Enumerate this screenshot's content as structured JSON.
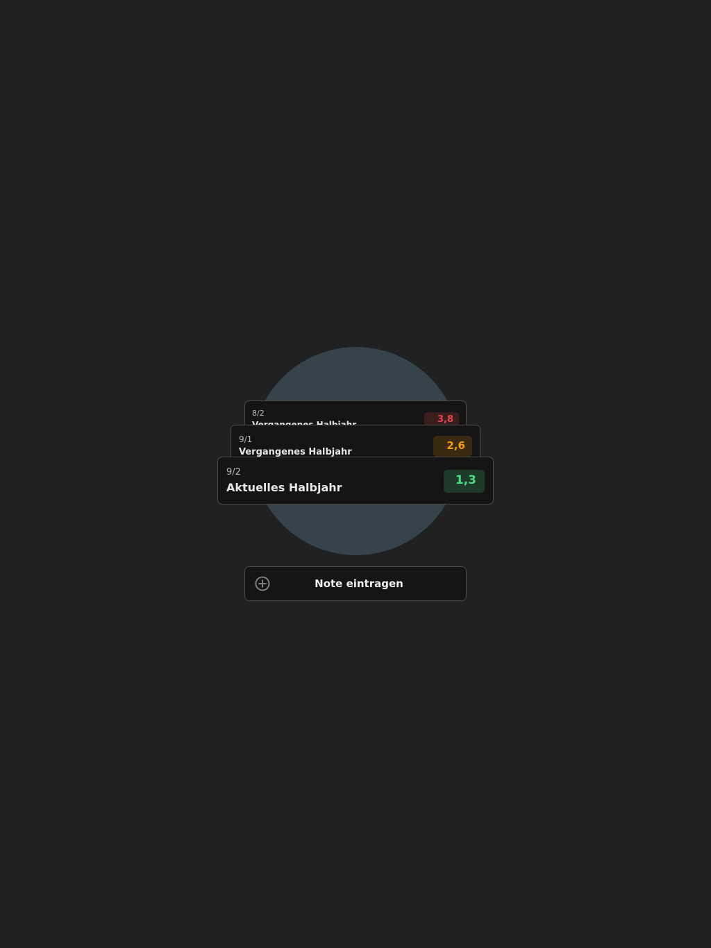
{
  "cards": [
    {
      "term": "8/2",
      "title": "Vergangenes Halbjahr",
      "grade": "3,8",
      "grade_color": "#e5484d",
      "grade_bg": "#3a1d1d"
    },
    {
      "term": "9/1",
      "title": "Vergangenes Halbjahr",
      "grade": "2,6",
      "grade_color": "#f59e0b",
      "grade_bg": "#3a2a12"
    },
    {
      "term": "9/2",
      "title": "Aktuelles Halbjahr",
      "grade": "1,3",
      "grade_color": "#4ade80",
      "grade_bg": "#1e3a2a"
    }
  ],
  "add_button": {
    "label": "Note eintragen",
    "icon": "plus-circle-icon"
  },
  "colors": {
    "background": "#212121",
    "circle": "#37434a",
    "card": "#151515",
    "card_border": "#4a4a4a"
  }
}
